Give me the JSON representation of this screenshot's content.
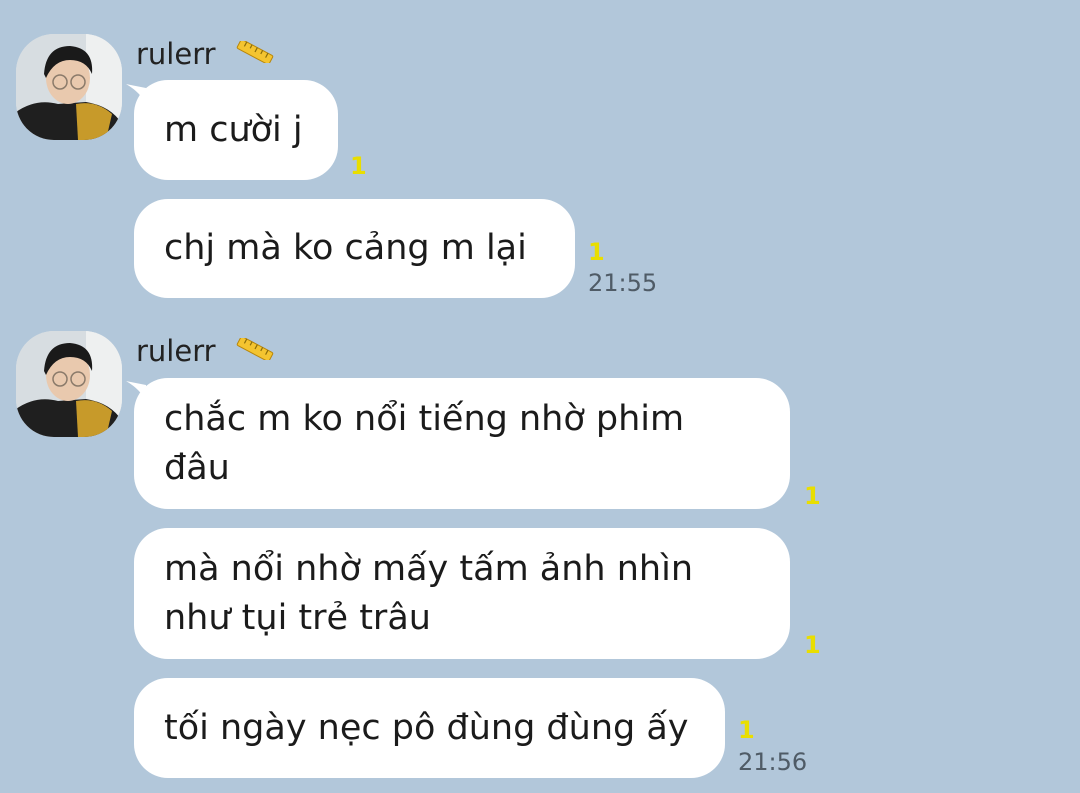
{
  "colors": {
    "background": "#b2c7da",
    "bubble": "#ffffff",
    "unread": "#e9de00",
    "timestamp": "#4f5b66"
  },
  "groups": [
    {
      "sender": "rulerr",
      "sender_icon": "ruler-icon",
      "messages": [
        {
          "text": "m cười j",
          "unread": "1"
        },
        {
          "text": "chj mà ko cảng m lại",
          "unread": "1",
          "time": "21:55"
        }
      ]
    },
    {
      "sender": "rulerr",
      "sender_icon": "ruler-icon",
      "messages": [
        {
          "text": "chắc m ko nổi tiếng nhờ phim đâu",
          "unread": "1"
        },
        {
          "text": "mà nổi nhờ mấy tấm ảnh nhìn như tụi trẻ trâu",
          "unread": "1"
        },
        {
          "text": "tối ngày nẹc pô đùng đùng ấy",
          "unread": "1",
          "time": "21:56"
        }
      ]
    }
  ]
}
